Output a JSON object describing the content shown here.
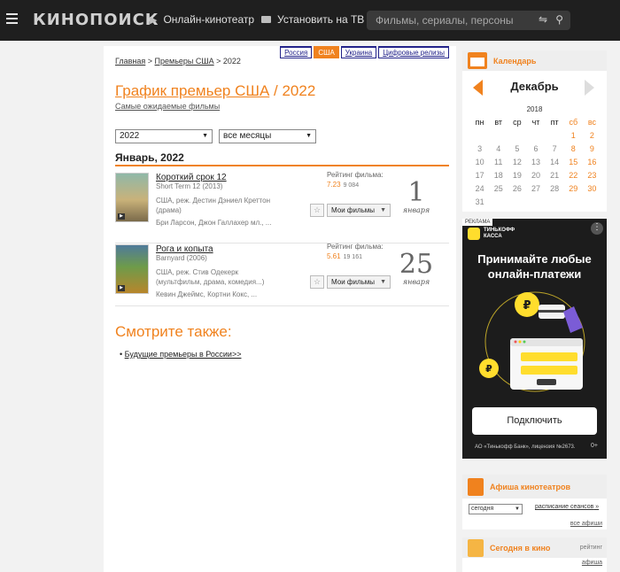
{
  "header": {
    "logo": "КИНОПОИСК",
    "nav_online": "Онлайн-кинотеатр",
    "nav_tv": "Установить на ТВ",
    "search_placeholder": "Фильмы, сериалы, персоны"
  },
  "country_tabs": [
    "Россия",
    "США",
    "Украина",
    "Цифровые релизы"
  ],
  "active_country": "США",
  "breadcrumb": {
    "home": "Главная",
    "sep1": " > ",
    "section": "Премьеры США",
    "sep2": " > ",
    "current": "2022"
  },
  "page": {
    "title_link": "График премьер США",
    "title_rest": " / 2022",
    "subtitle_link": "Самые ожидаемые фильмы"
  },
  "filters": {
    "year": "2022",
    "month": "все месяцы"
  },
  "month_heading": "Январь, 2022",
  "movies": [
    {
      "title": "Короткий срок 12",
      "original": "Short Term 12 (2013)",
      "info": "США, реж. Дестин Дэниел Креттон (драма)",
      "cast": "Бри Ларсон, Джон Галлахер мл., ...",
      "rating_label": "Рейтинг фильма:",
      "rating": "7.23",
      "votes": "9 084",
      "my_films": "Мои фильмы",
      "day": "1",
      "month": "января"
    },
    {
      "title": "Рога и копыта",
      "original": "Barnyard (2006)",
      "info": "США, реж. Стив Одекерк (мультфильм, драма, комедия...)",
      "cast": "Кевин Джеймс, Кортни Кокс, ...",
      "rating_label": "Рейтинг фильма:",
      "rating": "5.61",
      "votes": "19 161",
      "my_films": "Мои фильмы",
      "day": "25",
      "month": "января"
    }
  ],
  "see_also": {
    "heading": "Смотрите также:",
    "links": [
      "Будущие премьеры в России>>"
    ]
  },
  "calendar": {
    "header": "Календарь",
    "month": "Декабрь",
    "year": "2018",
    "weekdays": [
      "пн",
      "вт",
      "ср",
      "чт",
      "пт",
      "сб",
      "вс"
    ],
    "days": [
      "",
      "",
      "",
      "",
      "",
      "1",
      "2",
      "3",
      "4",
      "5",
      "6",
      "7",
      "8",
      "9",
      "10",
      "11",
      "12",
      "13",
      "14",
      "15",
      "16",
      "17",
      "18",
      "19",
      "20",
      "21",
      "22",
      "23",
      "24",
      "25",
      "26",
      "27",
      "28",
      "29",
      "30",
      "31",
      "",
      "",
      "",
      "",
      "",
      ""
    ]
  },
  "ad": {
    "tag": "РЕКЛАМА",
    "brand_line1": "ТИНЬКОФФ",
    "brand_line2": "КАССА",
    "title": "Принимайте любые онлайн-платежи",
    "button": "Подключить",
    "legal": "АО «Тинькофф Банк», лицензия №2673.",
    "age": "0+",
    "colors": {
      "background": "#1c1c1c",
      "accent": "#ffdd2d"
    }
  },
  "afisha": {
    "header": "Афиша кинотеатров",
    "select": "сегодня",
    "schedule_link": "расписание сеансов",
    "all_link": "все афиши"
  },
  "today_block": {
    "header": "Сегодня в кино",
    "rating": "рейтинг",
    "afisha_link": "афиша"
  },
  "colors": {
    "accent": "#f0821e",
    "header_bg": "#1f1f1f",
    "link_blue": "#23238a"
  }
}
